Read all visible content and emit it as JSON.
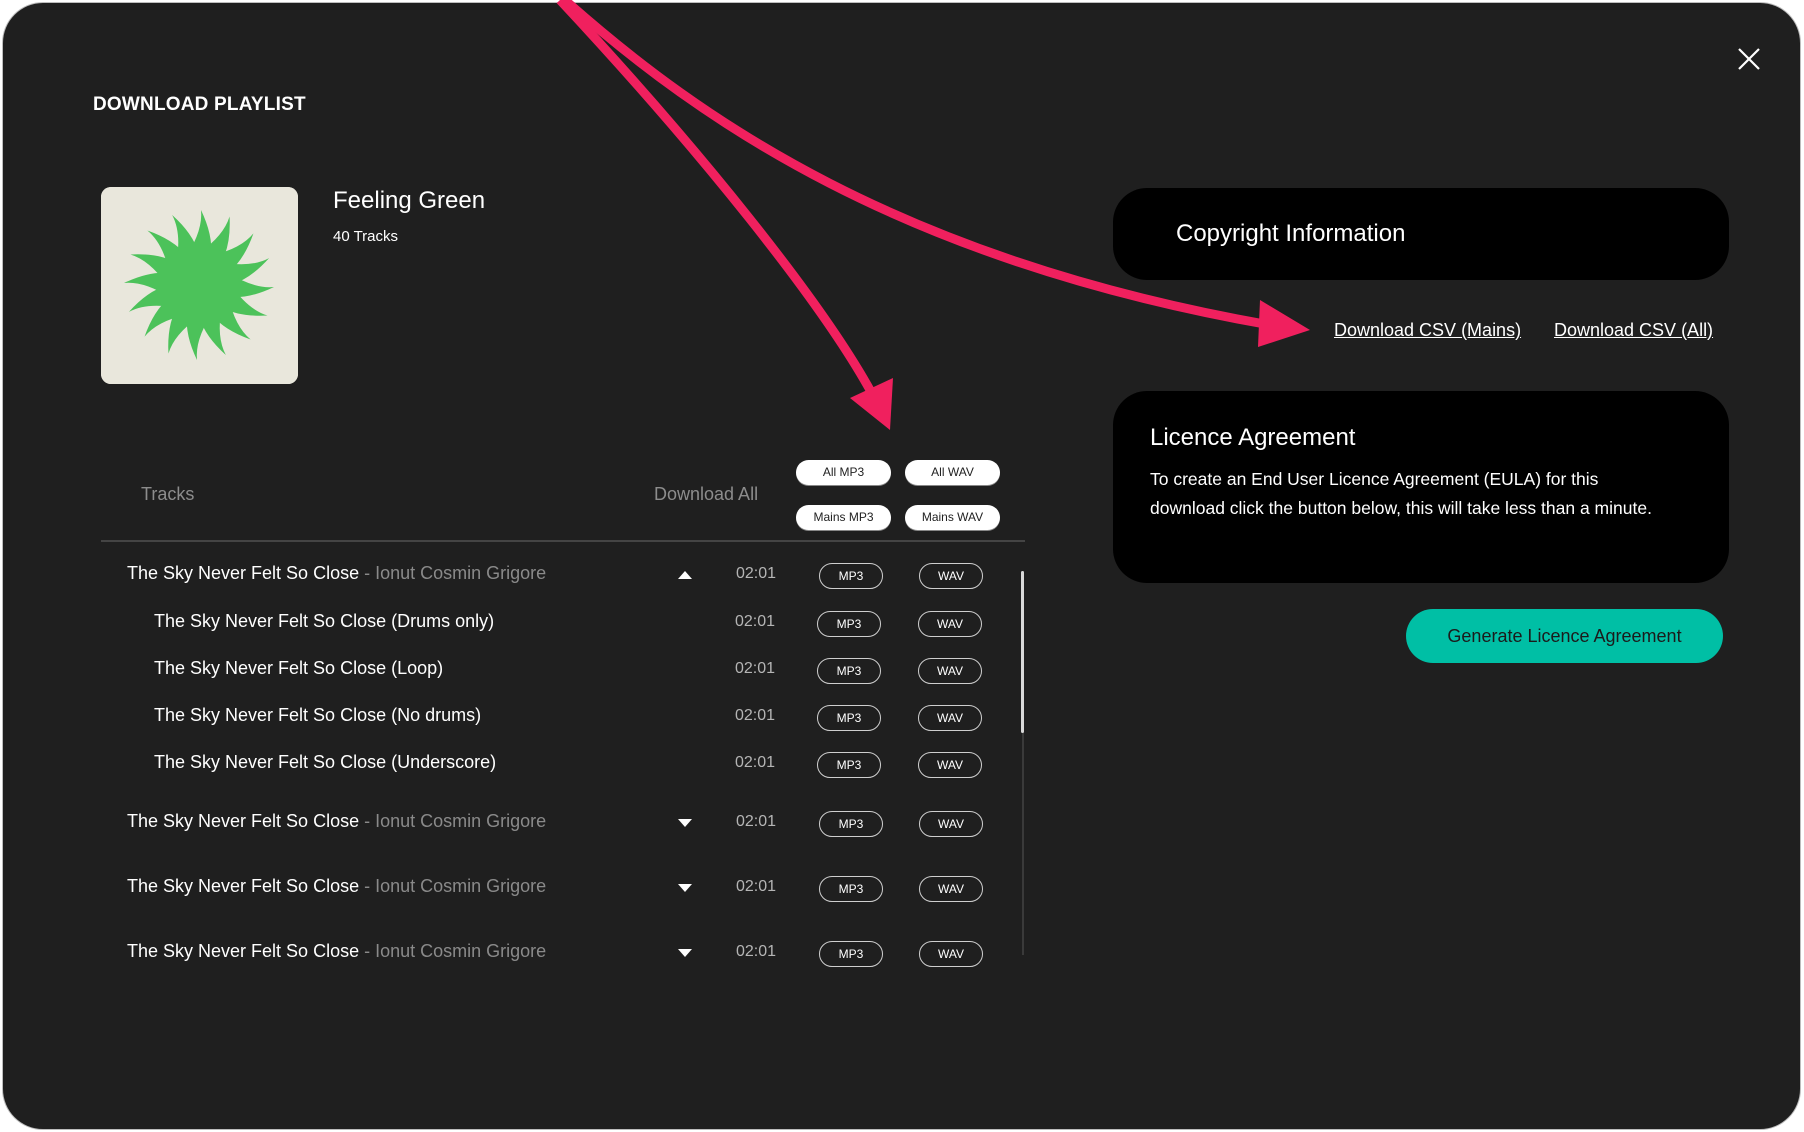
{
  "dialog": {
    "title": "DOWNLOAD PLAYLIST",
    "close_icon": "close-icon"
  },
  "playlist": {
    "name": "Feeling Green",
    "track_count": "40 Tracks",
    "art": {
      "background": "#e9e7dc",
      "shape_color": "#4cc25a",
      "description": "green sun"
    }
  },
  "table": {
    "header_tracks": "Tracks",
    "header_download_all": "Download All",
    "download_all_buttons": {
      "all_mp3": "All MP3",
      "all_wav": "All WAV",
      "mains_mp3": "Mains MP3",
      "mains_wav": "Mains WAV"
    },
    "rows": [
      {
        "title": "The Sky Never Felt So Close",
        "separator": " - ",
        "artist": "Ionut Cosmin Grigore",
        "duration": "02:01",
        "mp3": "MP3",
        "wav": "WAV",
        "expanded": true,
        "is_version": false
      },
      {
        "title": "The Sky Never Felt So Close (Drums only)",
        "duration": "02:01",
        "mp3": "MP3",
        "wav": "WAV",
        "is_version": true
      },
      {
        "title": "The Sky Never Felt So Close (Loop)",
        "duration": "02:01",
        "mp3": "MP3",
        "wav": "WAV",
        "is_version": true
      },
      {
        "title": "The Sky Never Felt So Close (No drums)",
        "duration": "02:01",
        "mp3": "MP3",
        "wav": "WAV",
        "is_version": true
      },
      {
        "title": "The Sky Never Felt So Close (Underscore)",
        "duration": "02:01",
        "mp3": "MP3",
        "wav": "WAV",
        "is_version": true
      },
      {
        "title": "The Sky Never Felt So Close",
        "separator": " - ",
        "artist": "Ionut Cosmin Grigore",
        "duration": "02:01",
        "mp3": "MP3",
        "wav": "WAV",
        "expanded": false,
        "is_version": false
      },
      {
        "title": "The Sky Never Felt So Close",
        "separator": " - ",
        "artist": "Ionut Cosmin Grigore",
        "duration": "02:01",
        "mp3": "MP3",
        "wav": "WAV",
        "expanded": false,
        "is_version": false
      },
      {
        "title": "The Sky Never Felt So Close",
        "separator": " - ",
        "artist": "Ionut Cosmin Grigore",
        "duration": "02:01",
        "mp3": "MP3",
        "wav": "WAV",
        "expanded": false,
        "is_version": false
      }
    ],
    "scroll_position_fraction": 0.0
  },
  "copyright": {
    "title": "Copyright Information",
    "csv_mains": "Download CSV (Mains)",
    "csv_all": "Download CSV (All)"
  },
  "licence": {
    "title": "Licence Agreement",
    "body": "To create an End User Licence Agreement (EULA) for this download click the button below, this will take less than a minute.",
    "button": "Generate Licence Agreement"
  },
  "colors": {
    "panel_bg": "#1f1f1f",
    "box_bg": "#000000",
    "accent": "#00bfa5",
    "annotation_arrow": "#f0205e",
    "muted_text": "#8c8c8c"
  }
}
